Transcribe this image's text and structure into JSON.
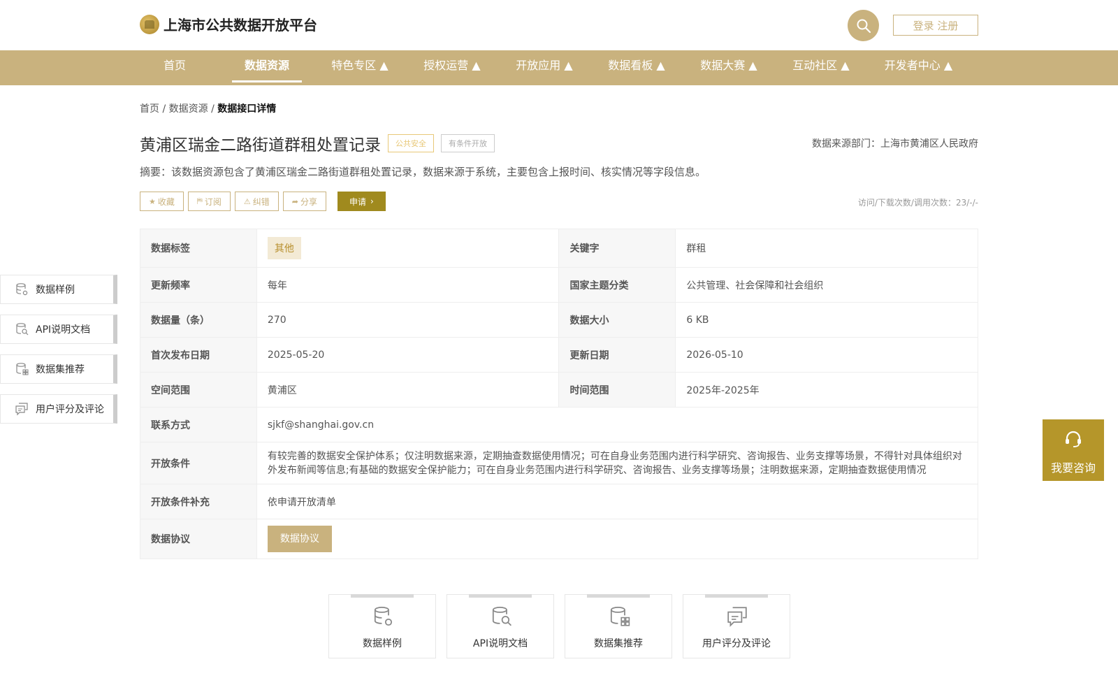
{
  "header": {
    "site_title": "上海市公共数据开放平台",
    "login_label": "登录 注册"
  },
  "nav": [
    {
      "label": "首页"
    },
    {
      "label": "数据资源"
    },
    {
      "label": "特色专区 ▲"
    },
    {
      "label": "授权运营 ▲"
    },
    {
      "label": "开放应用 ▲"
    },
    {
      "label": "数据看板 ▲"
    },
    {
      "label": "数据大赛 ▲"
    },
    {
      "label": "互动社区 ▲"
    },
    {
      "label": "开发者中心 ▲"
    }
  ],
  "breadcrumb": {
    "home": "首页",
    "sep": "/",
    "resources": "数据资源",
    "current": "数据接口详情"
  },
  "dataset": {
    "title": "黄浦区瑞金二路街道群租处置记录",
    "tag_security": "公共安全",
    "tag_open": "有条件开放",
    "source": "数据来源部门：上海市黄浦区人民政府",
    "abstract": "摘要：该数据资源包含了黄浦区瑞金二路街道群租处置记录，数据来源于系统，主要包含上报时间、核实情况等字段信息。",
    "visits": "访问/下载次数/调用次数：23/-/-"
  },
  "actions": {
    "collect": "收藏",
    "subscribe": "订阅",
    "report": "纠错",
    "share": "分享",
    "apply": "申请"
  },
  "info": {
    "tag_label": "数据标签",
    "tag_value": "其他",
    "keyword_label": "关键字",
    "keyword_value": "群租",
    "freq_label": "更新频率",
    "freq_value": "每年",
    "theme_label": "国家主题分类",
    "theme_value": "公共管理、社会保障和社会组织",
    "count_label": "数据量（条）",
    "count_value": "270",
    "size_label": "数据大小",
    "size_value": "6 KB",
    "first_pub_label": "首次发布日期",
    "first_pub_value": "2025-05-20",
    "update_label": "更新日期",
    "update_value": "2026-05-10",
    "space_label": "空间范围",
    "space_value": "黄浦区",
    "time_label": "时间范围",
    "time_value": "2025年-2025年",
    "contact_label": "联系方式",
    "contact_value": "sjkf@shanghai.gov.cn",
    "condition_label": "开放条件",
    "condition_value": "有较完善的数据安全保护体系；仅注明数据来源，定期抽查数据使用情况；可在自身业务范围内进行科学研究、咨询报告、业务支撑等场景，不得针对具体组织对外发布新闻等信息;有基础的数据安全保护能力；可在自身业务范围内进行科学研究、咨询报告、业务支撑等场景；注明数据来源，定期抽查数据使用情况",
    "supplement_label": "开放条件补充",
    "supplement_value": "依申请开放清单",
    "protocol_label": "数据协议",
    "protocol_button": "数据协议"
  },
  "side_nav": [
    {
      "label": "数据样例",
      "icon": "database-gear-icon"
    },
    {
      "label": "API说明文档",
      "icon": "doc-search-icon"
    },
    {
      "label": "数据集推荐",
      "icon": "database-grid-icon"
    },
    {
      "label": "用户评分及评论",
      "icon": "comment-icon"
    }
  ],
  "bottom_cards": [
    {
      "label": "数据样例"
    },
    {
      "label": "API说明文档"
    },
    {
      "label": "数据集推荐"
    },
    {
      "label": "用户评分及评论"
    }
  ],
  "consult": {
    "label": "我要咨询"
  },
  "colors": {
    "primary": "#c9b27e",
    "apply": "#a08a1e",
    "consult": "#b5962a",
    "tag_security": "#e8c878"
  }
}
